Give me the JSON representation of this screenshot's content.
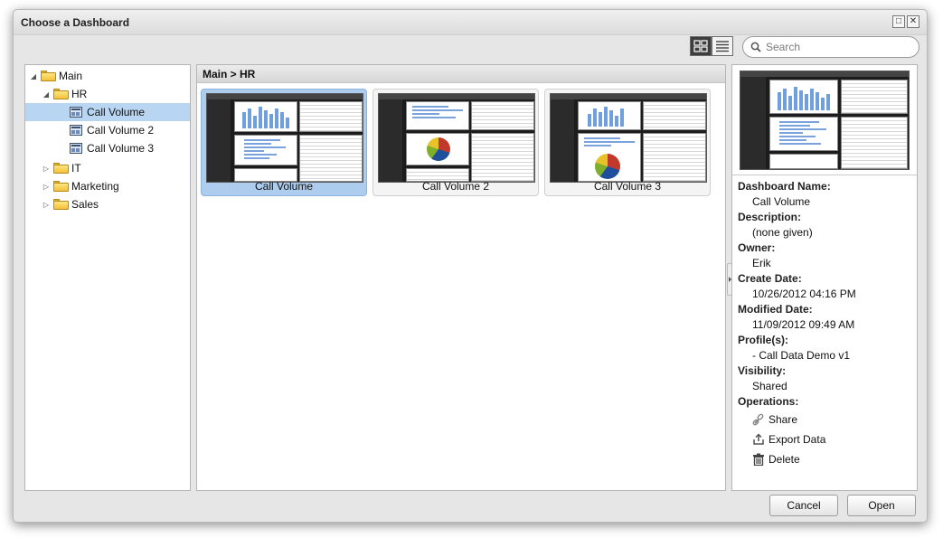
{
  "dialog": {
    "title": "Choose a Dashboard"
  },
  "window_buttons": {
    "maximize": "□",
    "close": "✕"
  },
  "toolbar": {
    "view_mode": "grid",
    "search_placeholder": "Search"
  },
  "tree": {
    "nodes": [
      {
        "label": "Main",
        "type": "folder",
        "level": 0,
        "expanded": true
      },
      {
        "label": "HR",
        "type": "folder",
        "level": 1,
        "expanded": true
      },
      {
        "label": "Call Volume",
        "type": "dashboard",
        "level": 2,
        "selected": true
      },
      {
        "label": "Call Volume 2",
        "type": "dashboard",
        "level": 2
      },
      {
        "label": "Call Volume 3",
        "type": "dashboard",
        "level": 2
      },
      {
        "label": "IT",
        "type": "folder",
        "level": 1,
        "expanded": false
      },
      {
        "label": "Marketing",
        "type": "folder",
        "level": 1,
        "expanded": false
      },
      {
        "label": "Sales",
        "type": "folder",
        "level": 1,
        "expanded": false
      }
    ]
  },
  "center": {
    "breadcrumb": "Main > HR",
    "thumbnails": [
      {
        "label": "Call Volume",
        "selected": true
      },
      {
        "label": "Call Volume 2",
        "selected": false
      },
      {
        "label": "Call Volume 3",
        "selected": false
      }
    ]
  },
  "details": {
    "dashboard_name_label": "Dashboard Name:",
    "dashboard_name": "Call Volume",
    "description_label": "Description:",
    "description": "(none given)",
    "owner_label": "Owner:",
    "owner": "Erik",
    "create_date_label": "Create Date:",
    "create_date": "10/26/2012 04:16 PM",
    "modified_date_label": "Modified Date:",
    "modified_date": "11/09/2012 09:49 AM",
    "profiles_label": "Profile(s):",
    "profiles": "- Call Data Demo v1",
    "visibility_label": "Visibility:",
    "visibility": "Shared",
    "operations_label": "Operations:",
    "operations": {
      "share": "Share",
      "export": "Export Data",
      "delete": "Delete"
    }
  },
  "footer": {
    "cancel": "Cancel",
    "open": "Open"
  },
  "colors": {
    "selection": "#b8d6f2",
    "thumb_selected": "#aecdee",
    "folder": "#f3c23a"
  }
}
